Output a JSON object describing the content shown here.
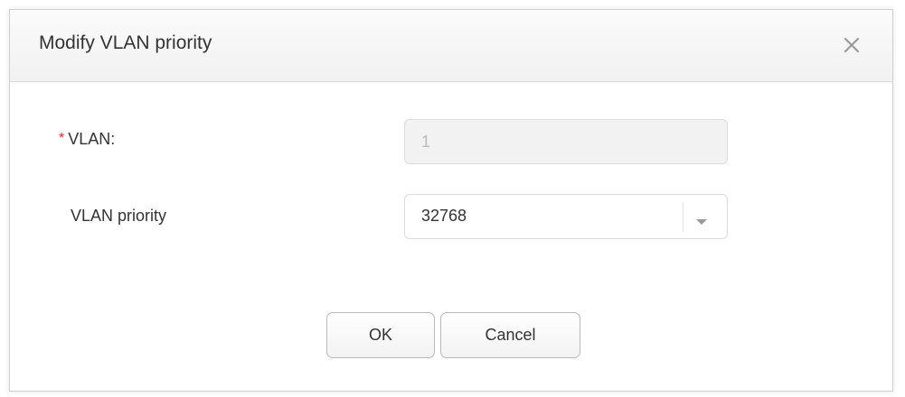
{
  "dialog": {
    "title": "Modify VLAN priority",
    "close_icon": "close-icon"
  },
  "form": {
    "vlan": {
      "required_mark": "*",
      "label": "VLAN:",
      "value": "1"
    },
    "priority": {
      "label": "VLAN priority",
      "selected": "32768",
      "dropdown_icon": "caret-down-icon"
    }
  },
  "buttons": {
    "ok_label": "OK",
    "cancel_label": "Cancel"
  },
  "colors": {
    "required": "#e6231e",
    "header_bg": "#f1f1f1",
    "disabled_input_bg": "#f2f2f2"
  }
}
